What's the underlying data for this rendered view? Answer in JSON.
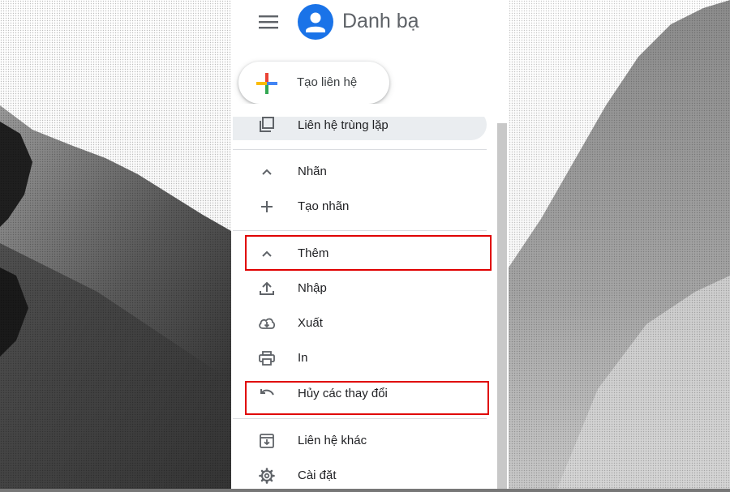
{
  "header": {
    "app_title": "Danh bạ",
    "menu_icon": "hamburger-menu-icon",
    "avatar_icon": "contacts-avatar-icon",
    "avatar_color": "#1a73e8"
  },
  "create_button": {
    "label": "Tạo liên hệ",
    "icon": "multicolor-plus-icon",
    "colors": [
      "#4285f4",
      "#ea4335",
      "#fbbc04",
      "#34a853"
    ]
  },
  "sidebar": {
    "items": [
      {
        "label": "Liên hệ trùng lặp",
        "icon": "copy-icon"
      },
      {
        "label": "Nhãn",
        "icon": "chevron-up-icon"
      },
      {
        "label": "Tạo nhãn",
        "icon": "plus-icon"
      },
      {
        "label": "Thêm",
        "icon": "chevron-up-icon"
      },
      {
        "label": "Nhập",
        "icon": "upload-icon"
      },
      {
        "label": "Xuất",
        "icon": "cloud-download-icon"
      },
      {
        "label": "In",
        "icon": "printer-icon"
      },
      {
        "label": "Hủy các thay đổi",
        "icon": "undo-icon"
      },
      {
        "label": "Liên hệ khác",
        "icon": "archive-icon"
      },
      {
        "label": "Cài đặt",
        "icon": "gear-icon"
      }
    ]
  },
  "highlight_color": "#e00000"
}
